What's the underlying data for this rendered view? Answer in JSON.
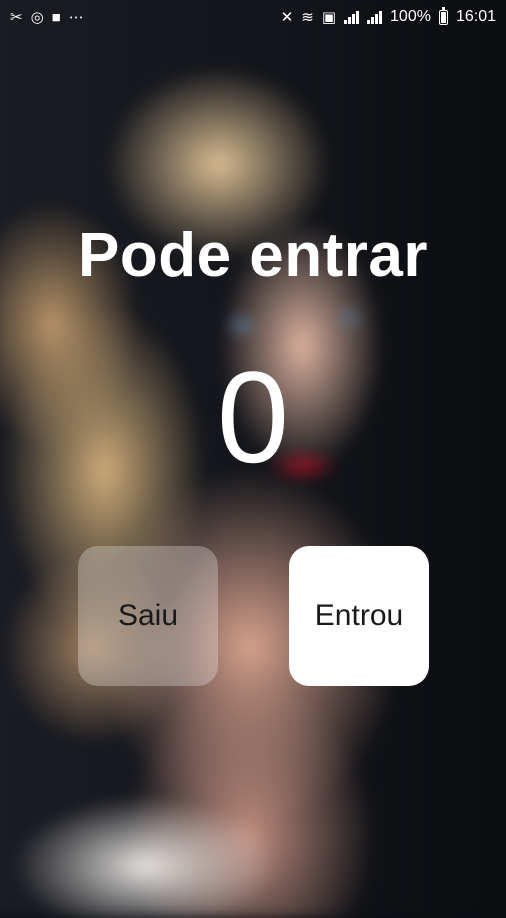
{
  "status_bar": {
    "left_icons": [
      "notification-icon",
      "target-icon",
      "message-icon",
      "more-icon"
    ],
    "right_icons": [
      "mute-icon",
      "wifi-icon",
      "sim-icon",
      "signal-icon",
      "signal-icon"
    ],
    "battery_text": "100%",
    "time": "16:01"
  },
  "main": {
    "title": "Pode entrar",
    "count": "0"
  },
  "buttons": {
    "left_label": "Saiu",
    "right_label": "Entrou"
  },
  "colors": {
    "text": "#ffffff",
    "button_primary": "#ffffff",
    "button_secondary": "rgba(255,255,255,0.28)"
  }
}
